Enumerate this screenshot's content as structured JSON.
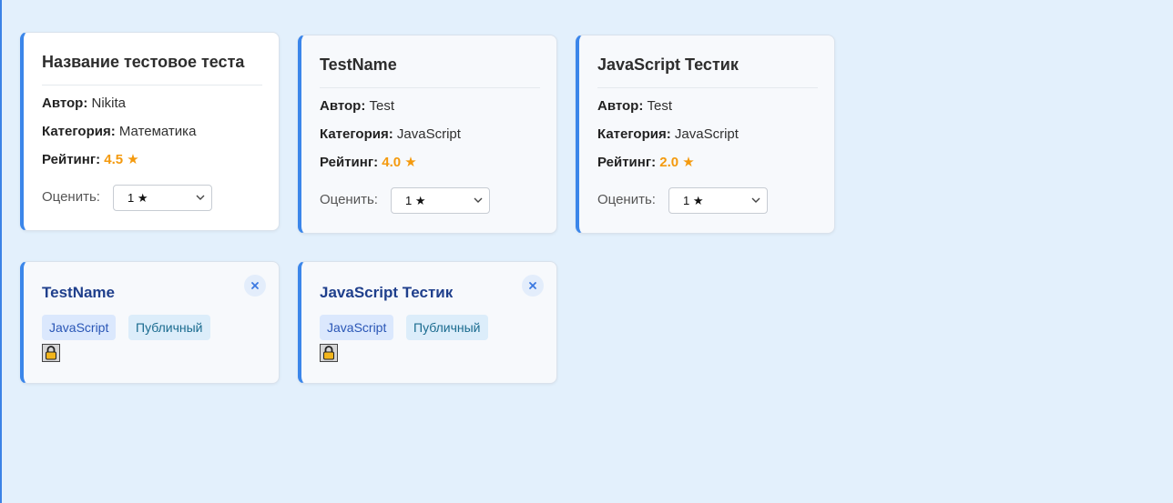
{
  "tests": [
    {
      "title": "Название тестовое теста",
      "author_label": "Автор:",
      "author": "Nikita",
      "category_label": "Категория:",
      "category": "Математика",
      "rating_label": "Рейтинг:",
      "rating": "4.5 ★",
      "rate_label": "Оценить:",
      "rate_value": "1 ★"
    },
    {
      "title": "TestName",
      "author_label": "Автор:",
      "author": "Test",
      "category_label": "Категория:",
      "category": "JavaScript",
      "rating_label": "Рейтинг:",
      "rating": "4.0 ★",
      "rate_label": "Оценить:",
      "rate_value": "1 ★"
    },
    {
      "title": "JavaScript Тестик",
      "author_label": "Автор:",
      "author": "Test",
      "category_label": "Категория:",
      "category": "JavaScript",
      "rating_label": "Рейтинг:",
      "rating": "2.0 ★",
      "rate_label": "Оценить:",
      "rate_value": "1 ★"
    }
  ],
  "my_tests": [
    {
      "title": "TestName",
      "category_tag": "JavaScript",
      "visibility_tag": "Публичный",
      "close_icon": "close-icon",
      "lock_icon": "lock-icon"
    },
    {
      "title": "JavaScript Тестик",
      "category_tag": "JavaScript",
      "visibility_tag": "Публичный",
      "close_icon": "close-icon",
      "lock_icon": "lock-icon"
    }
  ],
  "colors": {
    "background": "#e3f0fc",
    "accent": "#3b86ea",
    "rating": "#f49a0e",
    "mini_title": "#1f3f8c"
  }
}
